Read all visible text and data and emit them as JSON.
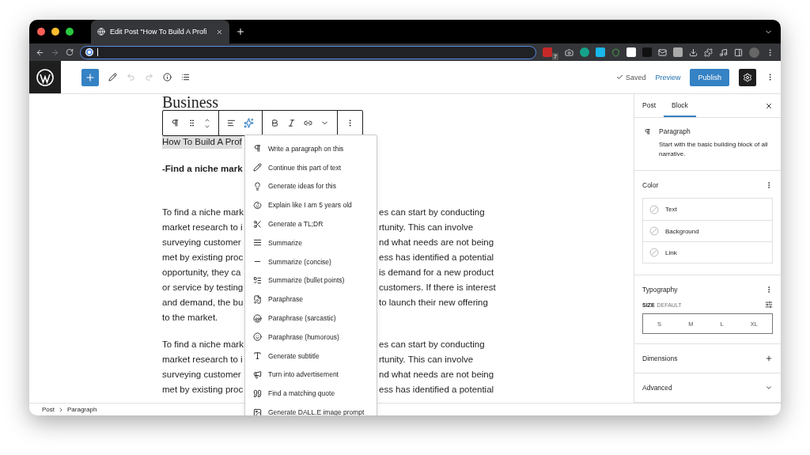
{
  "browser": {
    "tab_title": "Edit Post “How To Build A Profi",
    "forward_disabled": true,
    "extension_badge": "7"
  },
  "toolbar": {
    "history": [
      {
        "kind": "undo",
        "disabled": true
      },
      {
        "kind": "redo",
        "disabled": true
      }
    ],
    "saved": "Saved",
    "preview": "Preview",
    "publish": "Publish"
  },
  "block_toolbar": {
    "more_open": false
  },
  "editor": {
    "title": "Business",
    "heading": {
      "text": "How To Build A Prof",
      "selected": true
    },
    "subheading": "-Find a niche mark",
    "paragraphs": [
      {
        "lines": [
          {
            "left": "To find a niche mark",
            "right": "es can start by conducting"
          },
          {
            "left": "market research to i",
            "right": "rtunity. This can involve"
          },
          {
            "left": "surveying customer",
            "right": "nd what needs are not being"
          },
          {
            "left": "met by existing proc",
            "right": "ess has identified a potential"
          },
          {
            "left": "opportunity, they ca",
            "right": "is demand for a new product"
          },
          {
            "left": "or service by testing",
            "right": "customers. If there is interest"
          },
          {
            "left": "and demand, the bu",
            "right": "to launch their new offering"
          },
          {
            "left": "to the market."
          }
        ]
      },
      {
        "lines": [
          {
            "left": "To find a niche mark",
            "right": "es can start by conducting"
          },
          {
            "left": "market research to i",
            "right": "rtunity. This can involve"
          },
          {
            "left": "surveying customer",
            "right": "nd what needs are not being"
          },
          {
            "left": "met by existing proc",
            "right": "ess has identified a potential"
          }
        ]
      }
    ]
  },
  "ai_menu": {
    "items": [
      "Write a paragraph on this",
      "Continue this part of text",
      "Generate ideas for this",
      "Explain like I am 5 years old",
      "Generate a TL;DR",
      "Summarize",
      "Summarize (concise)",
      "Summarize (bullet points)",
      "Paraphrase",
      "Paraphrase (sarcastic)",
      "Paraphrase (humorous)",
      "Generate subtitle",
      "Turn into advertisement",
      "Find a matching quote",
      "Generate DALL.E image prompt"
    ]
  },
  "sidebar": {
    "tabs": [
      {
        "label": "Post",
        "selected": false
      },
      {
        "label": "Block",
        "selected": true
      }
    ],
    "block": {
      "name": "Paragraph",
      "description": "Start with the basic building block of all narrative."
    },
    "color": {
      "title": "Color",
      "items": [
        "Text",
        "Background",
        "Link"
      ]
    },
    "typography": {
      "title": "Typography",
      "size_label": "SIZE",
      "size_value": "DEFAULT",
      "sizes": [
        {
          "label": "S",
          "selected": false
        },
        {
          "label": "M",
          "selected": false
        },
        {
          "label": "L",
          "selected": false
        },
        {
          "label": "XL",
          "selected": false
        }
      ]
    },
    "panels": [
      {
        "title": "Dimensions",
        "kind": "add"
      },
      {
        "title": "Advanced",
        "kind": "expand"
      }
    ]
  },
  "breadcrumb": [
    "Post",
    "Paragraph"
  ]
}
